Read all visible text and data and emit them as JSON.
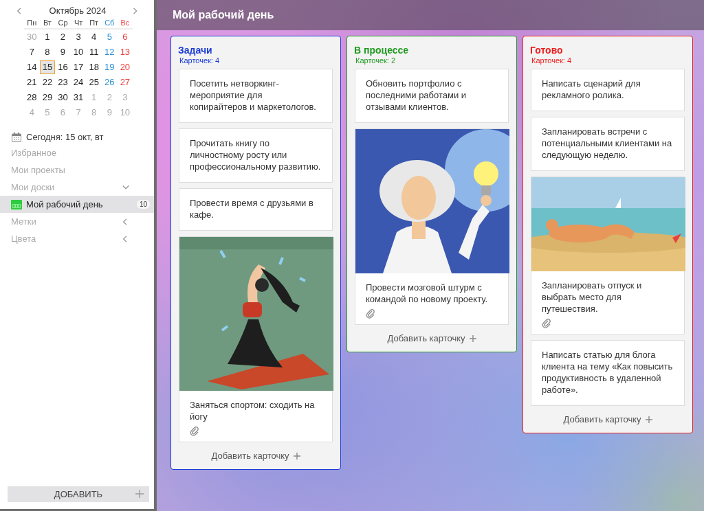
{
  "calendar": {
    "title": "Октябрь 2024",
    "weekdays": [
      {
        "label": "Пн",
        "kind": "normal"
      },
      {
        "label": "Вт",
        "kind": "normal"
      },
      {
        "label": "Ср",
        "kind": "normal"
      },
      {
        "label": "Чт",
        "kind": "normal"
      },
      {
        "label": "Пт",
        "kind": "normal"
      },
      {
        "label": "Сб",
        "kind": "sat"
      },
      {
        "label": "Вс",
        "kind": "sun"
      }
    ],
    "days": [
      {
        "day": "30",
        "kind": "muted",
        "selected": false
      },
      {
        "day": "1",
        "kind": "normal",
        "selected": false
      },
      {
        "day": "2",
        "kind": "normal",
        "selected": false
      },
      {
        "day": "3",
        "kind": "normal",
        "selected": false
      },
      {
        "day": "4",
        "kind": "normal",
        "selected": false
      },
      {
        "day": "5",
        "kind": "sat",
        "selected": false
      },
      {
        "day": "6",
        "kind": "sun",
        "selected": false
      },
      {
        "day": "7",
        "kind": "normal",
        "selected": false
      },
      {
        "day": "8",
        "kind": "normal",
        "selected": false
      },
      {
        "day": "9",
        "kind": "normal",
        "selected": false
      },
      {
        "day": "10",
        "kind": "normal",
        "selected": false
      },
      {
        "day": "11",
        "kind": "normal",
        "selected": false
      },
      {
        "day": "12",
        "kind": "sat",
        "selected": false
      },
      {
        "day": "13",
        "kind": "sun",
        "selected": false
      },
      {
        "day": "14",
        "kind": "normal",
        "selected": false
      },
      {
        "day": "15",
        "kind": "normal",
        "selected": true
      },
      {
        "day": "16",
        "kind": "normal",
        "selected": false
      },
      {
        "day": "17",
        "kind": "normal",
        "selected": false
      },
      {
        "day": "18",
        "kind": "normal",
        "selected": false
      },
      {
        "day": "19",
        "kind": "sat",
        "selected": false
      },
      {
        "day": "20",
        "kind": "sun",
        "selected": false
      },
      {
        "day": "21",
        "kind": "normal",
        "selected": false
      },
      {
        "day": "22",
        "kind": "normal",
        "selected": false
      },
      {
        "day": "23",
        "kind": "normal",
        "selected": false
      },
      {
        "day": "24",
        "kind": "normal",
        "selected": false
      },
      {
        "day": "25",
        "kind": "normal",
        "selected": false
      },
      {
        "day": "26",
        "kind": "sat",
        "selected": false
      },
      {
        "day": "27",
        "kind": "sun",
        "selected": false
      },
      {
        "day": "28",
        "kind": "normal",
        "selected": false
      },
      {
        "day": "29",
        "kind": "normal",
        "selected": false
      },
      {
        "day": "30",
        "kind": "normal",
        "selected": false
      },
      {
        "day": "31",
        "kind": "normal",
        "selected": false
      },
      {
        "day": "1",
        "kind": "muted",
        "selected": false
      },
      {
        "day": "2",
        "kind": "muted",
        "selected": false
      },
      {
        "day": "3",
        "kind": "muted",
        "selected": false
      },
      {
        "day": "4",
        "kind": "muted",
        "selected": false
      },
      {
        "day": "5",
        "kind": "muted",
        "selected": false
      },
      {
        "day": "6",
        "kind": "muted",
        "selected": false
      },
      {
        "day": "7",
        "kind": "muted",
        "selected": false
      },
      {
        "day": "8",
        "kind": "muted",
        "selected": false
      },
      {
        "day": "9",
        "kind": "muted",
        "selected": false
      },
      {
        "day": "10",
        "kind": "muted",
        "selected": false
      }
    ]
  },
  "today": "Сегодня: 15 окт, вт",
  "nav": [
    {
      "label": "Избранное",
      "kind": "link"
    },
    {
      "label": "Мои проекты",
      "kind": "link"
    },
    {
      "label": "Мои доски",
      "kind": "section",
      "expanded": true
    },
    {
      "label": "Мой рабочий день",
      "kind": "board",
      "count": "10",
      "selected": true
    },
    {
      "label": "Метки",
      "kind": "section",
      "expanded": false
    },
    {
      "label": "Цвета",
      "kind": "section",
      "expanded": false
    }
  ],
  "add_button": "ДОБАВИТЬ",
  "board_title": "Мой рабочий день",
  "columns": [
    {
      "title": "Задачи",
      "count": "Карточек: 4",
      "color": "#1a3bd6",
      "add": "Добавить карточку",
      "cards": [
        {
          "text": "Посетить нетворкинг-мероприятие для копирайтеров и маркетологов.",
          "attachment": false
        },
        {
          "text": "Прочитать книгу по личностному росту или профессиональному развитию.",
          "attachment": false
        },
        {
          "text": "Провести время с друзьями в кафе.",
          "attachment": false
        },
        {
          "text": "Заняться спортом: сходить на йогу",
          "kind": "picture",
          "attachment": true
        }
      ]
    },
    {
      "title": "В процессе",
      "count": "Карточек: 2",
      "color": "#1f9a1f",
      "add": "Добавить карточку",
      "cards": [
        {
          "text": "Обновить портфолио с последними работами и отзывами клиентов.",
          "attachment": false
        },
        {
          "text": "Провести мозговой штурм с командой по новому проекту.",
          "kind": "picture",
          "attachment": true
        }
      ]
    },
    {
      "title": "Готово",
      "count": "Карточек: 4",
      "color": "#ee1c1c",
      "add": "Добавить карточку",
      "cards": [
        {
          "text": "Написать сценарий для рекламного ролика.",
          "attachment": false
        },
        {
          "text": "Запланировать встречи с потенциальными клиентами на следующую неделю.",
          "attachment": false
        },
        {
          "text": "Запланировать отпуск и выбрать место для путешествия.",
          "kind": "picture",
          "attachment": true
        },
        {
          "text": "Написать статью для блога клиента на тему «Как повысить продуктивность в удаленной работе».",
          "attachment": false
        }
      ]
    }
  ]
}
